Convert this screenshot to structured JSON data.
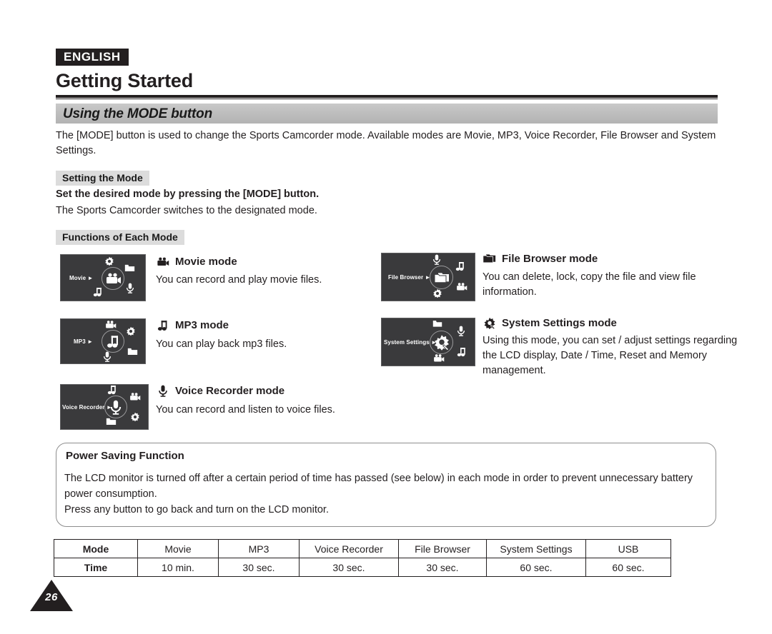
{
  "header": {
    "language_badge": "ENGLISH",
    "chapter_title": "Getting Started",
    "section_title": "Using the MODE button"
  },
  "intro": "The [MODE] button is used to change the Sports Camcorder mode. Available modes are Movie, MP3, Voice Recorder, File Browser and System Settings.",
  "setting_the_mode": {
    "subhead": "Setting the Mode",
    "bold_line": "Set the desired mode by pressing the [MODE] button.",
    "plain_line": "The Sports Camcorder switches to the designated mode."
  },
  "functions_subhead": "Functions of Each Mode",
  "modes": [
    {
      "lcd_label": "Movie",
      "heading": "Movie mode",
      "icon": "movie-camera-icon",
      "description": "You can record and play movie files.",
      "dial_center_icon": "movie-camera-icon",
      "satellites": [
        "gear-icon",
        "folder-icon",
        "microphone-icon",
        "music-note-icon"
      ]
    },
    {
      "lcd_label": "MP3",
      "heading": "MP3 mode",
      "icon": "music-note-icon",
      "description": "You can play back mp3 files.",
      "dial_center_icon": "music-note-icon",
      "satellites": [
        "movie-camera-icon",
        "gear-icon",
        "folder-icon",
        "microphone-icon"
      ]
    },
    {
      "lcd_label": "Voice Recorder",
      "heading": "Voice Recorder mode",
      "icon": "microphone-icon",
      "description": "You can record and listen to voice files.",
      "dial_center_icon": "microphone-icon",
      "satellites": [
        "music-note-icon",
        "movie-camera-icon",
        "gear-icon",
        "folder-icon"
      ]
    },
    {
      "lcd_label": "File Browser",
      "heading": "File Browser mode",
      "icon": "folder-icon",
      "description": "You can delete, lock, copy the file and view file information.",
      "dial_center_icon": "folder-icon",
      "satellites": [
        "microphone-icon",
        "music-note-icon",
        "movie-camera-icon",
        "gear-icon"
      ]
    },
    {
      "lcd_label": "System Settings",
      "heading": "System Settings mode",
      "icon": "gear-icon",
      "description": "Using this mode, you can set / adjust settings regarding the LCD display, Date / Time, Reset and Memory management.",
      "dial_center_icon": "gear-icon",
      "satellites": [
        "folder-icon",
        "microphone-icon",
        "music-note-icon",
        "movie-camera-icon"
      ]
    }
  ],
  "power_saving": {
    "title": "Power Saving Function",
    "line1": "The LCD monitor is turned off after a certain period of time has passed (see below) in each mode in order to prevent unnecessary battery power consumption.",
    "line2": "Press any button to go back and turn on the LCD monitor."
  },
  "table": {
    "rows": [
      {
        "label": "Mode",
        "cells": [
          "Movie",
          "MP3",
          "Voice Recorder",
          "File Browser",
          "System Settings",
          "USB"
        ]
      },
      {
        "label": "Time",
        "cells": [
          "10 min.",
          "30 sec.",
          "30 sec.",
          "30 sec.",
          "60 sec.",
          "60 sec."
        ]
      }
    ]
  },
  "page_number": "26",
  "colors": {
    "ink": "#231f20",
    "section_bar": "#bcbcbc",
    "subhead_bg": "#dcdcdc",
    "lcd_bg": "#3a3a3c",
    "lcd_border": "#5e5e60"
  }
}
